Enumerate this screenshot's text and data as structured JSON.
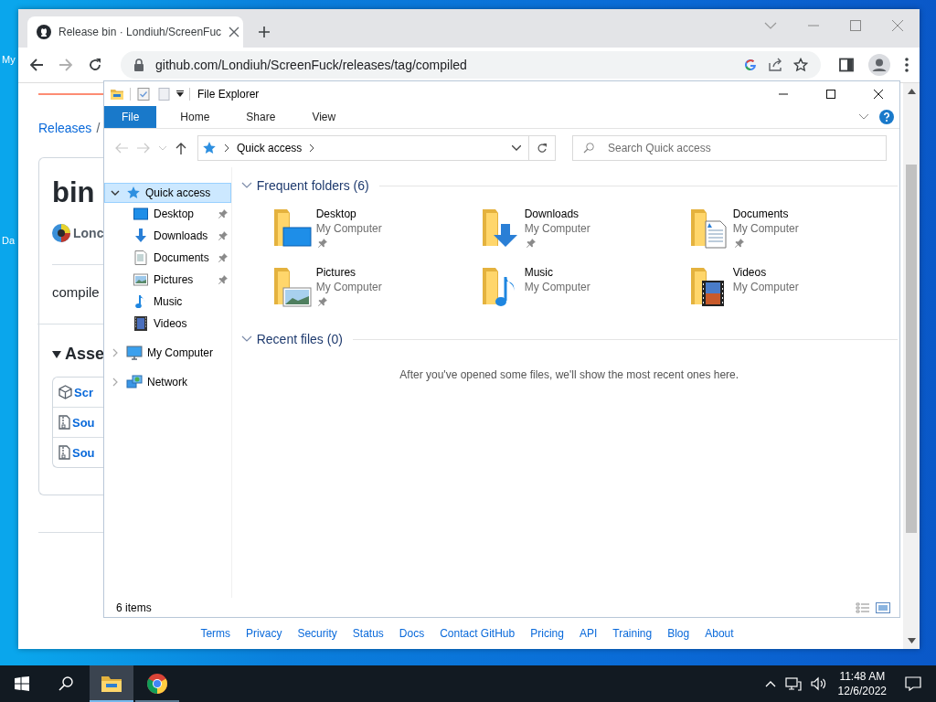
{
  "desktop": {
    "icon_labels": [
      "My",
      "Da"
    ]
  },
  "browser": {
    "tab": {
      "title": "Release bin · Londiuh/ScreenFuc"
    },
    "url": "github.com/Londiuh/ScreenFuck/releases/tag/compiled",
    "page": {
      "breadcrumb": [
        "Releases",
        "/"
      ],
      "heading": "bin",
      "author": "Lonc",
      "body": "compile",
      "assets_heading": "Asse",
      "assets": [
        {
          "kind": "package",
          "label": "Scr"
        },
        {
          "kind": "archive",
          "label": "Sou"
        },
        {
          "kind": "archive",
          "label": "Sou"
        }
      ],
      "footer_links": [
        "Terms",
        "Privacy",
        "Security",
        "Status",
        "Docs",
        "Contact GitHub",
        "Pricing",
        "API",
        "Training",
        "Blog",
        "About"
      ]
    }
  },
  "explorer": {
    "title": "File Explorer",
    "ribbon_tabs": [
      {
        "label": "File",
        "selected": true
      },
      {
        "label": "Home",
        "selected": false
      },
      {
        "label": "Share",
        "selected": false
      },
      {
        "label": "View",
        "selected": false
      }
    ],
    "address": {
      "location": "Quick access"
    },
    "search": {
      "placeholder": "Search Quick access"
    },
    "nav_pane": [
      {
        "label": "Quick access",
        "kind": "quick-access",
        "expanded": true,
        "selected": true,
        "children": [
          {
            "label": "Desktop",
            "kind": "desktop",
            "pinned": true,
            "selected": false
          },
          {
            "label": "Downloads",
            "kind": "downloads",
            "pinned": true,
            "selected": false
          },
          {
            "label": "Documents",
            "kind": "documents",
            "pinned": true,
            "selected": false
          },
          {
            "label": "Pictures",
            "kind": "pictures",
            "pinned": true,
            "selected": false
          },
          {
            "label": "Music",
            "kind": "music",
            "pinned": false,
            "selected": false
          },
          {
            "label": "Videos",
            "kind": "videos",
            "pinned": false,
            "selected": false
          }
        ]
      },
      {
        "label": "My Computer",
        "kind": "computer",
        "expanded": false,
        "selected": false
      },
      {
        "label": "Network",
        "kind": "network",
        "expanded": false,
        "selected": false
      }
    ],
    "sections": [
      {
        "title": "Frequent folders (6)",
        "expanded": true,
        "folders": [
          {
            "name": "Desktop",
            "location": "My Computer",
            "kind": "desktop",
            "pinned": true
          },
          {
            "name": "Downloads",
            "location": "My Computer",
            "kind": "downloads",
            "pinned": true
          },
          {
            "name": "Documents",
            "location": "My Computer",
            "kind": "documents",
            "pinned": true
          },
          {
            "name": "Pictures",
            "location": "My Computer",
            "kind": "pictures",
            "pinned": true
          },
          {
            "name": "Music",
            "location": "My Computer",
            "kind": "music",
            "pinned": false
          },
          {
            "name": "Videos",
            "location": "My Computer",
            "kind": "videos",
            "pinned": false
          }
        ]
      },
      {
        "title": "Recent files (0)",
        "expanded": true,
        "message": "After you've opened some files, we'll show the most recent ones here."
      }
    ],
    "status": "6 items"
  },
  "taskbar": {
    "apps": [
      {
        "kind": "explorer",
        "active": true
      },
      {
        "kind": "chrome",
        "active": false
      }
    ],
    "time": "11:48 AM",
    "date": "12/6/2022"
  }
}
